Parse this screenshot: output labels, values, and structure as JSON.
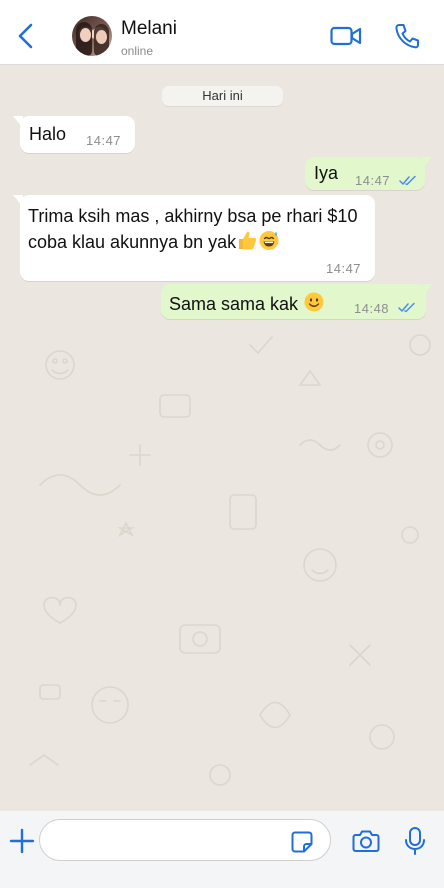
{
  "header": {
    "contact_name": "Melani",
    "status": "online",
    "icons": [
      "back-icon",
      "video-call-icon",
      "phone-icon"
    ]
  },
  "chat": {
    "date_label": "Hari ini",
    "messages": [
      {
        "direction": "incoming",
        "text": "Halo",
        "time": "14:47"
      },
      {
        "direction": "outgoing",
        "text": "Iya",
        "time": "14:47",
        "status": "read"
      },
      {
        "direction": "incoming",
        "text": "Trima ksih mas , akhirny bsa pe rhari $10 coba klau akunnya bn yak",
        "emoji": [
          "thumbs-up",
          "grinning-sweat"
        ],
        "time": "14:47"
      },
      {
        "direction": "outgoing",
        "text": "Sama sama kak",
        "emoji": [
          "smiling-face"
        ],
        "time": "14:48",
        "status": "read"
      }
    ]
  },
  "input_bar": {
    "placeholder": "",
    "icons": [
      "plus-icon",
      "sticker-icon",
      "camera-icon",
      "microphone-icon"
    ]
  },
  "colors": {
    "accent": "#1f6fd6",
    "chat_background": "#ebe6df",
    "outgoing_bubble": "#e2f7cb",
    "incoming_bubble": "#ffffff",
    "read_ticks": "#4a8fe7"
  }
}
